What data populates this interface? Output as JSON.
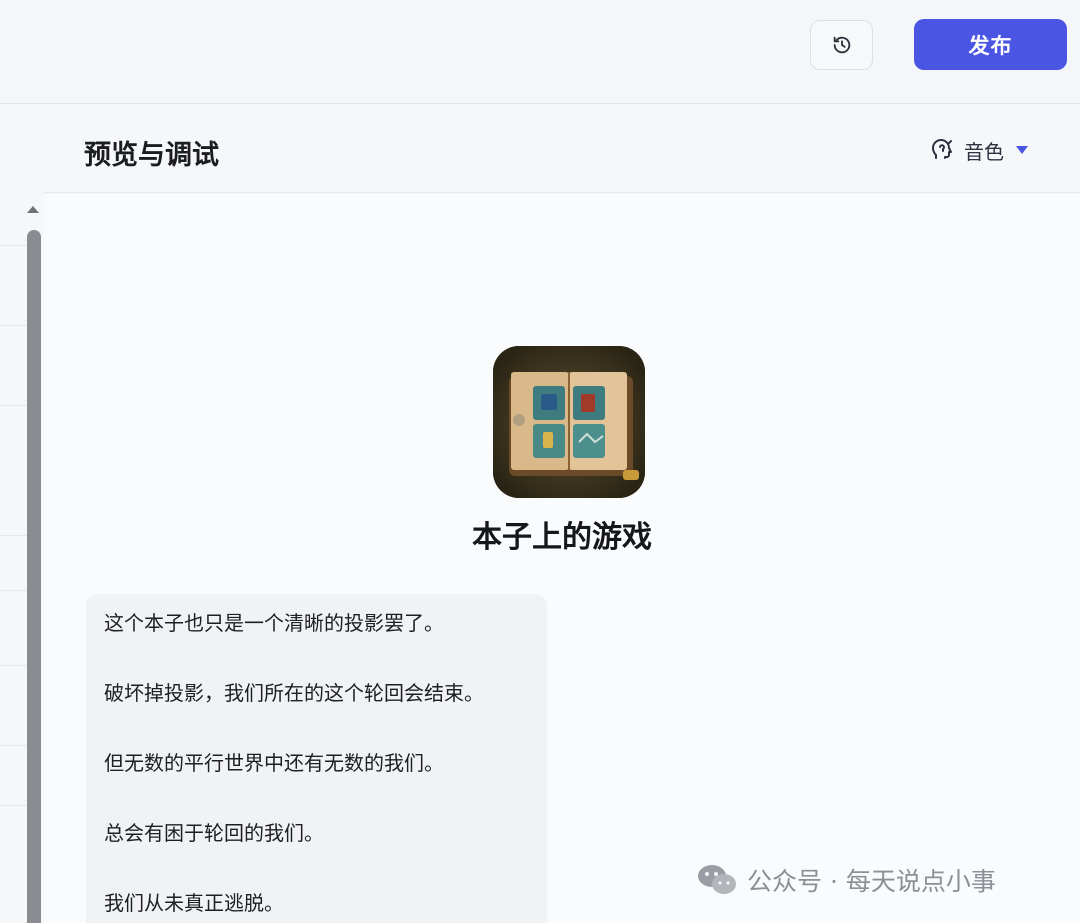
{
  "topbar": {
    "history_icon": "clock-history-icon",
    "publish_label": "发布"
  },
  "panel": {
    "title": "预览与调试",
    "voice_icon": "voice-tone-icon",
    "voice_label": "音色"
  },
  "bot": {
    "name": "本子上的游戏",
    "avatar_icon": "notebook-game-icon"
  },
  "messages": [
    "这个本子也只是一个清晰的投影罢了。",
    "破坏掉投影，我们所在的这个轮回会结束。",
    "但无数的平行世界中还有无数的我们。",
    "总会有困于轮回的我们。",
    "我们从未真正逃脱。"
  ],
  "watermark": {
    "icon": "wechat-icon",
    "text": "公众号 · 每天说点小事"
  },
  "colors": {
    "accent": "#4a55e4",
    "background": "#f4f5f8"
  }
}
